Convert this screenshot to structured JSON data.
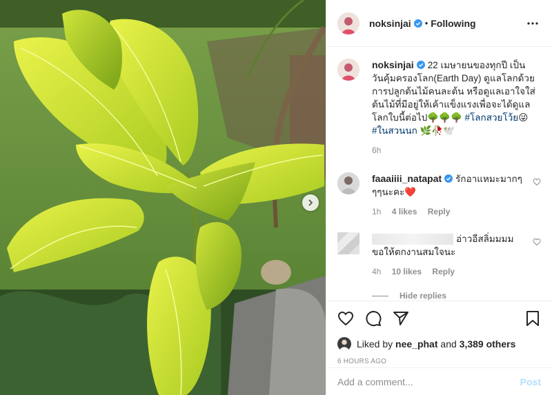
{
  "post": {
    "username": "noksinjai",
    "follow_status": "Following",
    "caption": "22 เมษายนของทุกปี เป็นวันคุ้มครองโลก(Earth Day) ดูแลโลกด้วยการปลูกต้นไม้คนละต้น หรือดูแลเอาใจใส่ต้นไม้ที่มีอยู่ให้เค้าแข็งแรงเพื่อจะได้ดูแลโลกใบนี้ต่อไป🌳🌳🌳",
    "hashtag1": "#โลกสวยโว้ย",
    "caption_emoji": "😜",
    "hashtag2": "#ในสวนนก",
    "caption_end_emoji": "🌿🥀🕊️",
    "caption_time": "6h"
  },
  "comments": [
    {
      "username": "faaaiiii_natapat",
      "text": "รักอาแหมะมากๆๆๆนะคะ❤️",
      "time": "1h",
      "likes": "4 likes",
      "reply": "Reply"
    },
    {
      "username": "",
      "text": "อ่าวอีสลิ่มมมม ขอให้ตกงานสมใจนะ",
      "time": "4h",
      "likes": "10 likes",
      "reply": "Reply"
    }
  ],
  "hide_replies": "Hide replies",
  "liked_by": {
    "prefix": "Liked by",
    "user": "nee_phat",
    "and": "and",
    "count": "3,389 others"
  },
  "timestamp": "6 HOURS AGO",
  "add_comment": {
    "placeholder": "Add a comment...",
    "post_label": "Post"
  },
  "icons": {
    "more": "more-options-icon",
    "like": "heart-icon",
    "comment": "comment-icon",
    "share": "share-icon",
    "save": "bookmark-icon",
    "carousel": "chevron-right-icon"
  },
  "colors": {
    "verified": "#3897f0",
    "heart": "#ed4956",
    "link": "#00376b",
    "muted": "#8e8e8e",
    "post_button": "#b2dffc"
  }
}
